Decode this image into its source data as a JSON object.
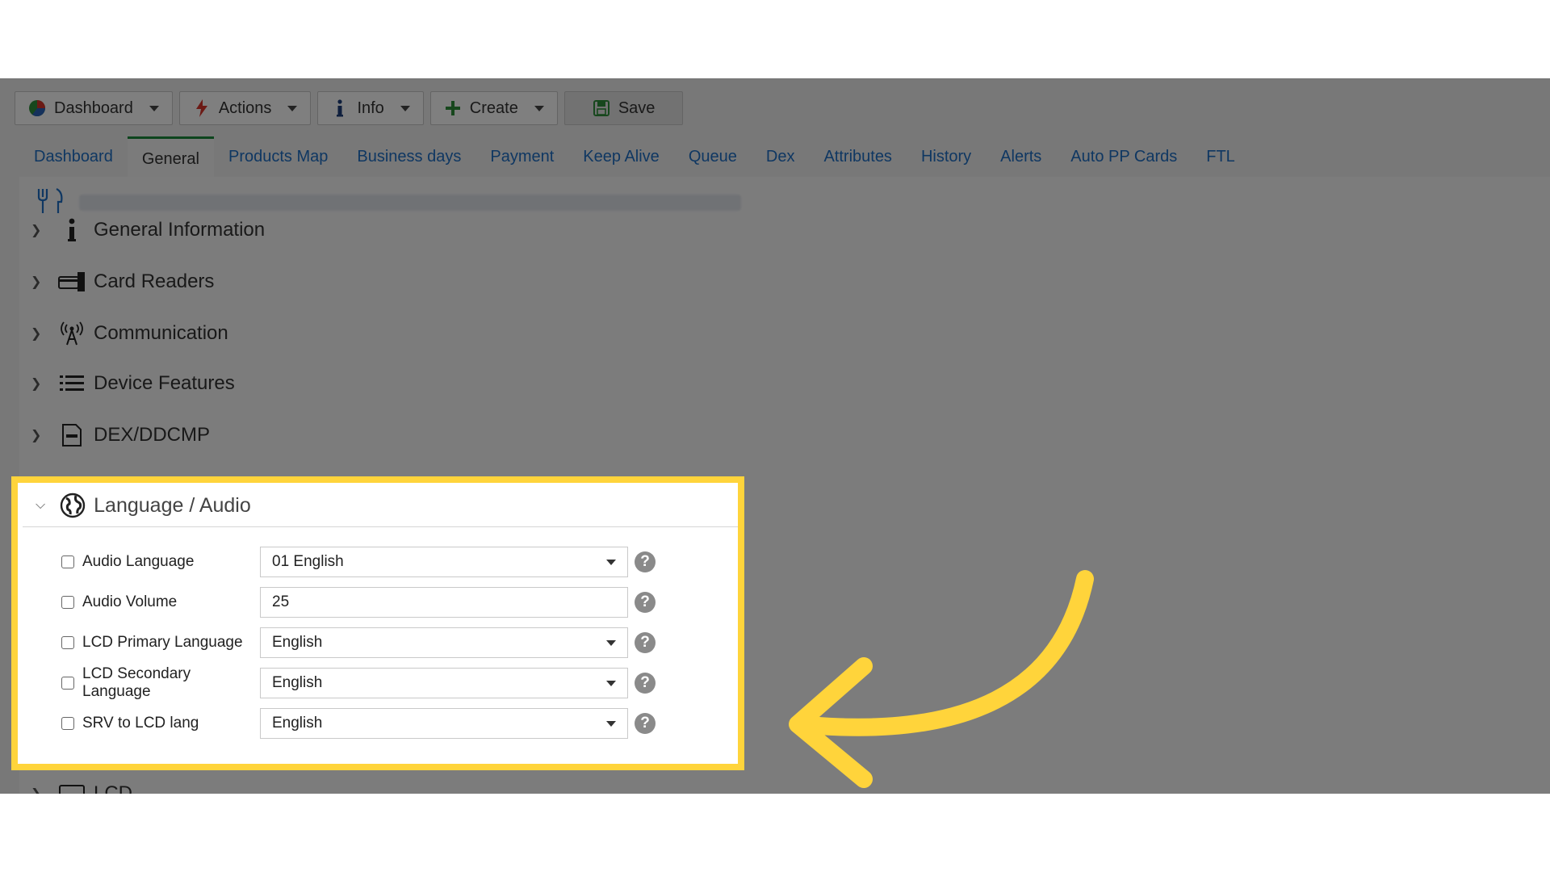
{
  "toolbar": {
    "dashboard_label": "Dashboard",
    "actions_label": "Actions",
    "info_label": "Info",
    "create_label": "Create",
    "save_label": "Save"
  },
  "tabs": [
    {
      "label": "Dashboard"
    },
    {
      "label": "General"
    },
    {
      "label": "Products Map"
    },
    {
      "label": "Business days"
    },
    {
      "label": "Payment"
    },
    {
      "label": "Keep Alive"
    },
    {
      "label": "Queue"
    },
    {
      "label": "Dex"
    },
    {
      "label": "Attributes"
    },
    {
      "label": "History"
    },
    {
      "label": "Alerts"
    },
    {
      "label": "Auto PP Cards"
    },
    {
      "label": "FTL"
    }
  ],
  "sections": [
    {
      "label": "General Information",
      "icon": "info-icon"
    },
    {
      "label": "Card Readers",
      "icon": "card-reader-icon"
    },
    {
      "label": "Communication",
      "icon": "antenna-icon"
    },
    {
      "label": "Device Features",
      "icon": "list-icon"
    },
    {
      "label": "DEX/DDCMP",
      "icon": "dex-icon"
    }
  ],
  "language_audio": {
    "title": "Language / Audio",
    "icon": "globe-icon",
    "rows": [
      {
        "label": "Audio Language",
        "value": "01 English",
        "type": "select"
      },
      {
        "label": "Audio Volume",
        "value": "25",
        "type": "input"
      },
      {
        "label": "LCD Primary Language",
        "value": "English",
        "type": "select"
      },
      {
        "label": "LCD Secondary Language",
        "value": "English",
        "type": "select"
      },
      {
        "label": "SRV to LCD lang",
        "value": "English",
        "type": "select"
      }
    ],
    "help_glyph": "?"
  },
  "next_section_label": "LCD",
  "colors": {
    "highlight": "#ffd43b",
    "tab_active_border": "#1a8a3a",
    "link": "#1e6fc5"
  }
}
